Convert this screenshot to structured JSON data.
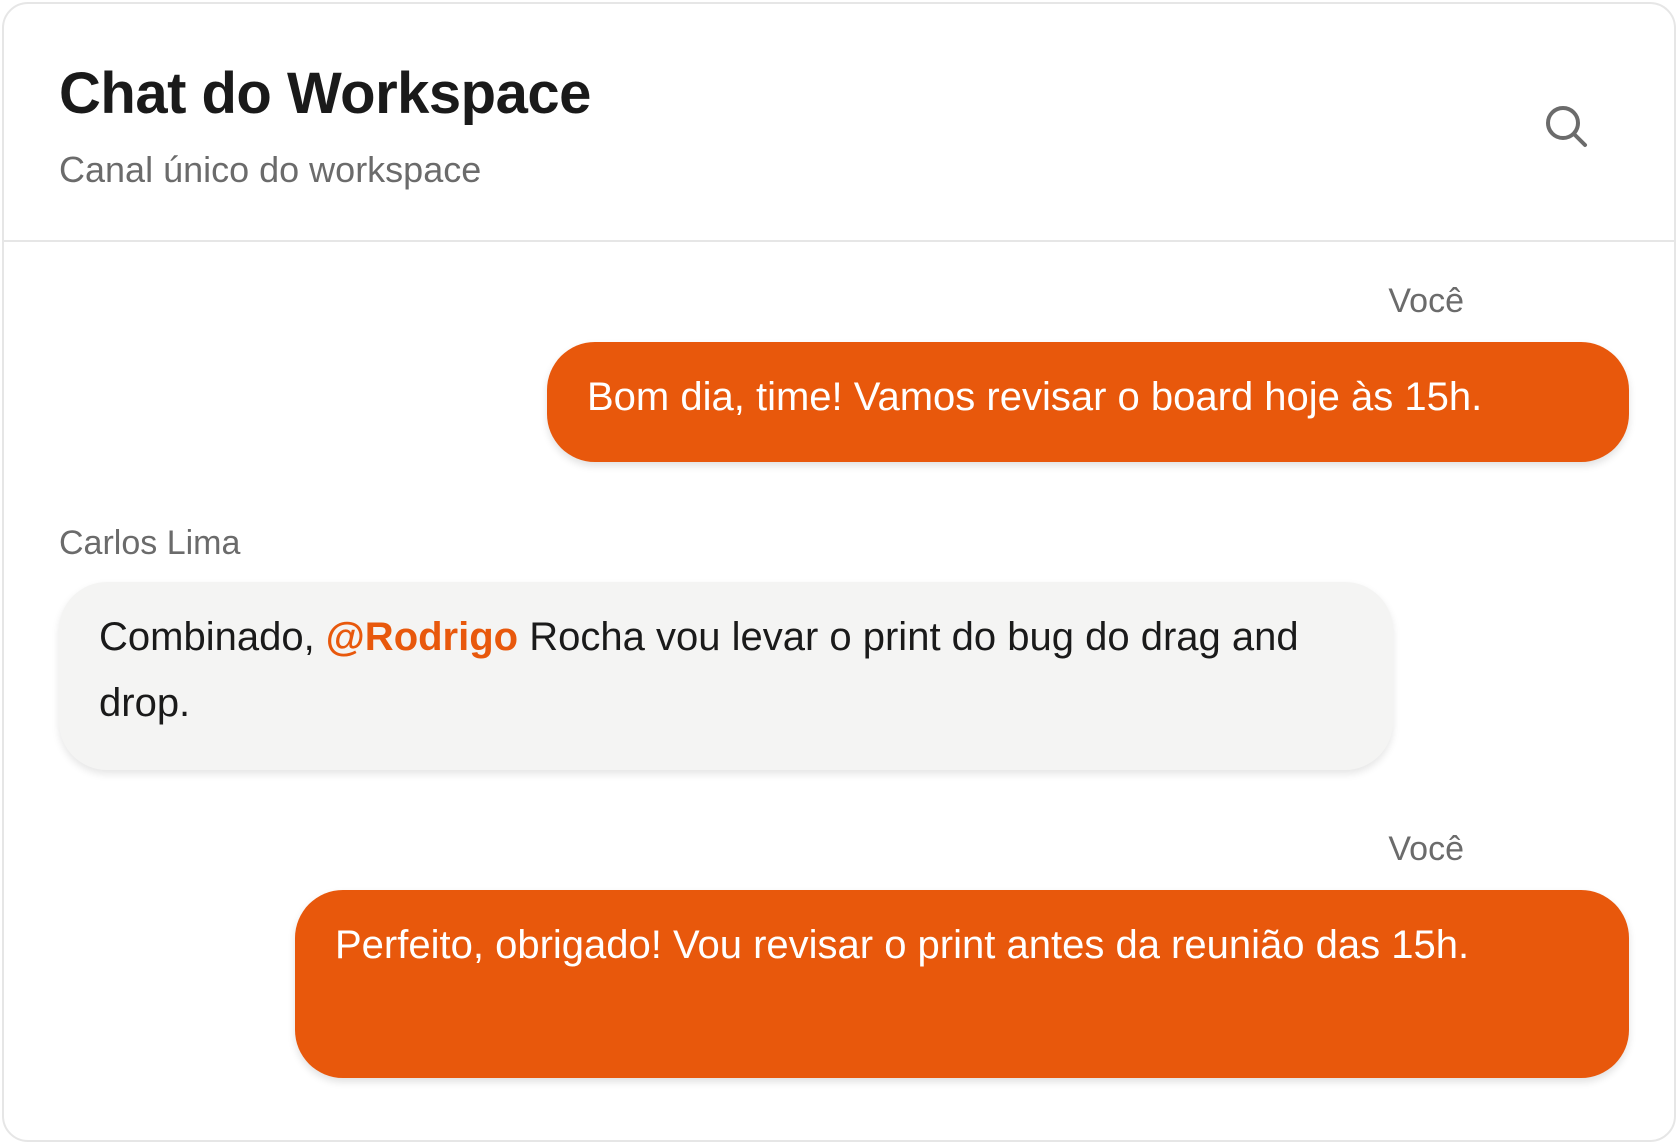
{
  "header": {
    "title": "Chat do Workspace",
    "subtitle": "Canal único do workspace",
    "search_icon": "search-icon"
  },
  "colors": {
    "accent": "#e8580c",
    "incoming_bubble": "#f4f4f3",
    "text_primary": "#1a1a1a",
    "text_muted": "#6b6b6b"
  },
  "messages": [
    {
      "sender": "Você",
      "own": true,
      "text": "Bom dia, time! Vamos revisar o board hoje às 15h."
    },
    {
      "sender": "Carlos Lima",
      "own": false,
      "text_before": "Combinado, ",
      "mention": "@Rodrigo",
      "text_after": " Rocha vou levar o print do bug do drag and drop."
    },
    {
      "sender": "Você",
      "own": true,
      "text": "Perfeito, obrigado! Vou revisar o print antes da reunião das 15h."
    }
  ]
}
